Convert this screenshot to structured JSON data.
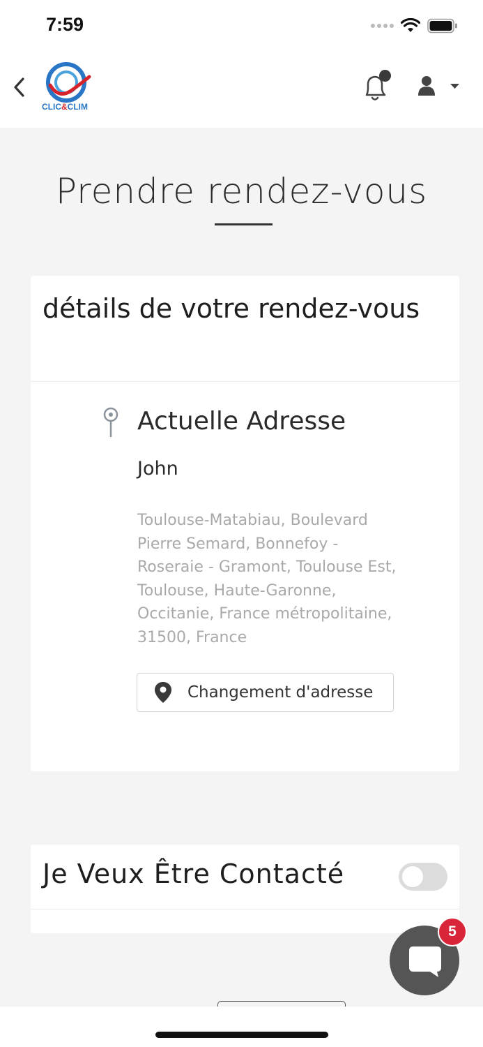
{
  "status_bar": {
    "time": "7:59"
  },
  "header": {
    "logo_text_left": "CLIC",
    "logo_text_amp": "&",
    "logo_text_right": "CLIM",
    "brand_blue": "#2876c5",
    "brand_red": "#d6232b"
  },
  "page": {
    "title": "Prendre rendez-vous"
  },
  "appointment_card": {
    "header": "détails de votre rendez-vous",
    "address_title": "Actuelle Adresse",
    "name": "John",
    "address": "Toulouse-Matabiau, Boulevard Pierre Semard, Bonnefoy - Roseraie - Gramont, Toulouse Est, Toulouse, Haute-Garonne, Occitanie, France métropolitaine, 31500, France",
    "change_button": "Changement d'adresse"
  },
  "contact_card": {
    "label": "Je Veux Être Contacté",
    "toggle_on": false
  },
  "chat": {
    "badge_count": "5"
  }
}
